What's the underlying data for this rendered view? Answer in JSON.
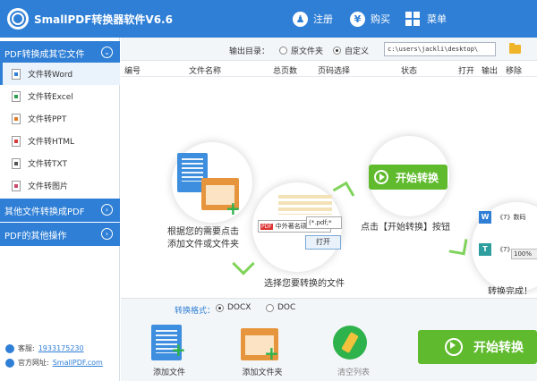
{
  "app": {
    "title": "SmallPDF转换器软件V6.6"
  },
  "titlebar": {
    "register": "注册",
    "buy": "购买",
    "menu": "菜单",
    "register_icon": "user-icon",
    "buy_icon": "yen-icon",
    "menu_icon": "grid-icon"
  },
  "sidebar": {
    "section1": "PDF转换成其它文件",
    "items": [
      {
        "label": "文件转Word",
        "icon": "word-file-icon"
      },
      {
        "label": "文件转Excel",
        "icon": "excel-file-icon"
      },
      {
        "label": "文件转PPT",
        "icon": "ppt-file-icon"
      },
      {
        "label": "文件转HTML",
        "icon": "html-file-icon"
      },
      {
        "label": "文件转TXT",
        "icon": "txt-file-icon"
      },
      {
        "label": "文件转图片",
        "icon": "image-file-icon"
      }
    ],
    "section2": "其他文件转换成PDF",
    "section3": "PDF的其他操作",
    "qq_label": "客服:",
    "qq_value": "1933175230",
    "site_label": "官方网址:",
    "site_value": "SmallPDF.com"
  },
  "output": {
    "label": "输出目录：",
    "option_original": "原文件夹",
    "option_custom": "自定义",
    "selected": "自定义",
    "path": "c:\\users\\jackli\\desktop\\"
  },
  "table": {
    "columns": [
      "编号",
      "文件名称",
      "总页数",
      "页码选择",
      "状态",
      "打开",
      "输出",
      "移除"
    ]
  },
  "tutorial": {
    "step1": "根据您的需要点击\n添加文件或文件夹",
    "step2": "选择您要转换的文件",
    "step3": "点击【开始转换】按钮",
    "step4": "转换完成！",
    "start_pill": "开始转换",
    "file_popup_name": "中外著名硕",
    "file_popup_filter": "(*.pdf;*",
    "file_popup_open": "打开",
    "progress_item_1": "《7》数码",
    "progress_item_2": "《7》",
    "progress_percent": "100%"
  },
  "format": {
    "label": "转换格式：",
    "options": [
      "DOCX",
      "DOC"
    ],
    "selected": "DOCX"
  },
  "toolbar": {
    "add_file": "添加文件",
    "add_folder": "添加文件夹",
    "clear_list": "清空列表",
    "start": "开始转换"
  },
  "colors": {
    "primary": "#2f7fd6",
    "green": "#5fbb2d"
  }
}
